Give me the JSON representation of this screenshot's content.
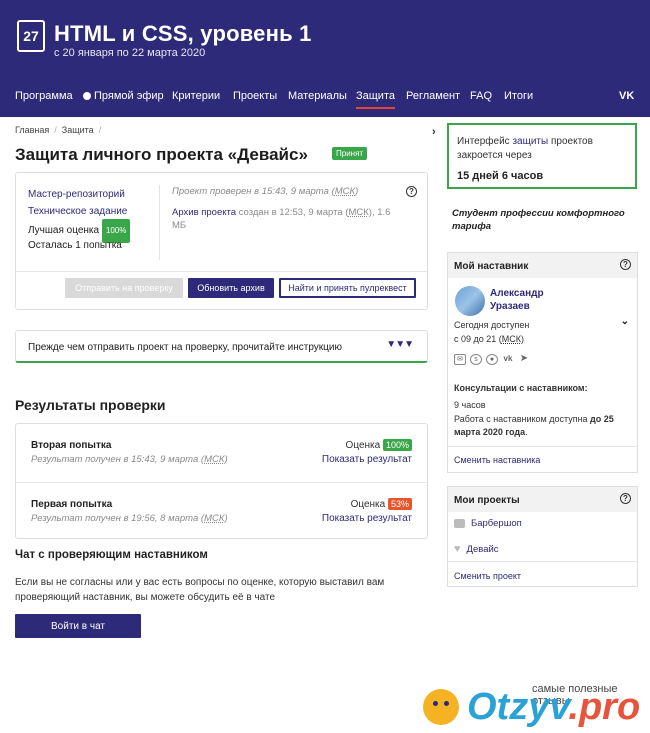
{
  "header": {
    "badge": "27",
    "title": "HTML и CSS, уровень 1",
    "dates": "с 20 января по 22 марта 2020"
  },
  "nav": {
    "items": [
      "Программа",
      "Прямой эфир",
      "Критерии",
      "Проекты",
      "Материалы",
      "Защита",
      "Регламент",
      "FAQ",
      "Итоги"
    ],
    "vk": "VK"
  },
  "breadcrumbs": [
    "Главная",
    "Защита"
  ],
  "page": {
    "title": "Защита личного проекта «Девайс»",
    "status": "Принят"
  },
  "info": {
    "repo": "Мастер-репозиторий",
    "spec": "Техническое задание",
    "best_score_label": "Лучшая оценка",
    "best_score": "100%",
    "attempts_left": "Осталась 1 попытка",
    "checked": "Проект проверен в 15:43, 9 марта (",
    "tz": "МСК",
    "checked_end": ")",
    "archive_link": "Архив проекта",
    "archive_meta": " создан в 12:53, 9 марта (",
    "archive_size": "), 1.6 МБ",
    "help": "?"
  },
  "buttons": {
    "send": "Отправить на проверку",
    "update": "Обновить архив",
    "pull": "Найти и принять пулреквест",
    "chat": "Войти в чат"
  },
  "instruction": {
    "text": "Прежде чем отправить проект на проверку, прочитайте инструкцию",
    "arrows": "▼▼▼"
  },
  "results": {
    "title": "Результаты проверки",
    "score_label": "Оценка",
    "show": "Показать результат",
    "rows": [
      {
        "name": "Вторая попытка",
        "received": "Результат получен в 15:43, 9 марта (",
        "score": "100%"
      },
      {
        "name": "Первая попытка",
        "received": "Результат получен в 19:56, 8 марта (",
        "score": "53%"
      }
    ]
  },
  "chat": {
    "title": "Чат с проверяющим наставником",
    "text": "Если вы не согласны или у вас есть вопросы по оценке, которую выставил вам проверяющий наставник, вы можете обсудить её в чате"
  },
  "sidebar": {
    "interface_text_1": "Интерфейс ",
    "interface_link": "защиты",
    "interface_text_2": " проектов закроется через",
    "interface_time": "15 дней 6 часов",
    "student": "Студент профессии комфортного тарифа",
    "mentor_title": "Мой наставник",
    "mentor_first": "Александр",
    "mentor_last": "Уразаев",
    "available": "Сегодня доступен",
    "hours": "с 09 до 21 (",
    "consult_label": "Консультации с наставником:",
    "consult_hours": "9 часов",
    "work_until_1": "Работа с наставником доступна ",
    "work_until_2": "до 25 марта 2020 года",
    "work_until_3": ".",
    "change_mentor": "Сменить наставника",
    "projects_title": "Мои проекты",
    "projects": [
      "Барбершоп",
      "Девайс"
    ],
    "change_project": "Сменить проект"
  },
  "watermark": {
    "tagline": "самые полезные отзывы",
    "brand_main": "Otzyv",
    "brand_end": ".pro"
  },
  "colors": {
    "brand": "#2e2a7a",
    "success": "#3aa64a",
    "warning": "#e8552d"
  }
}
